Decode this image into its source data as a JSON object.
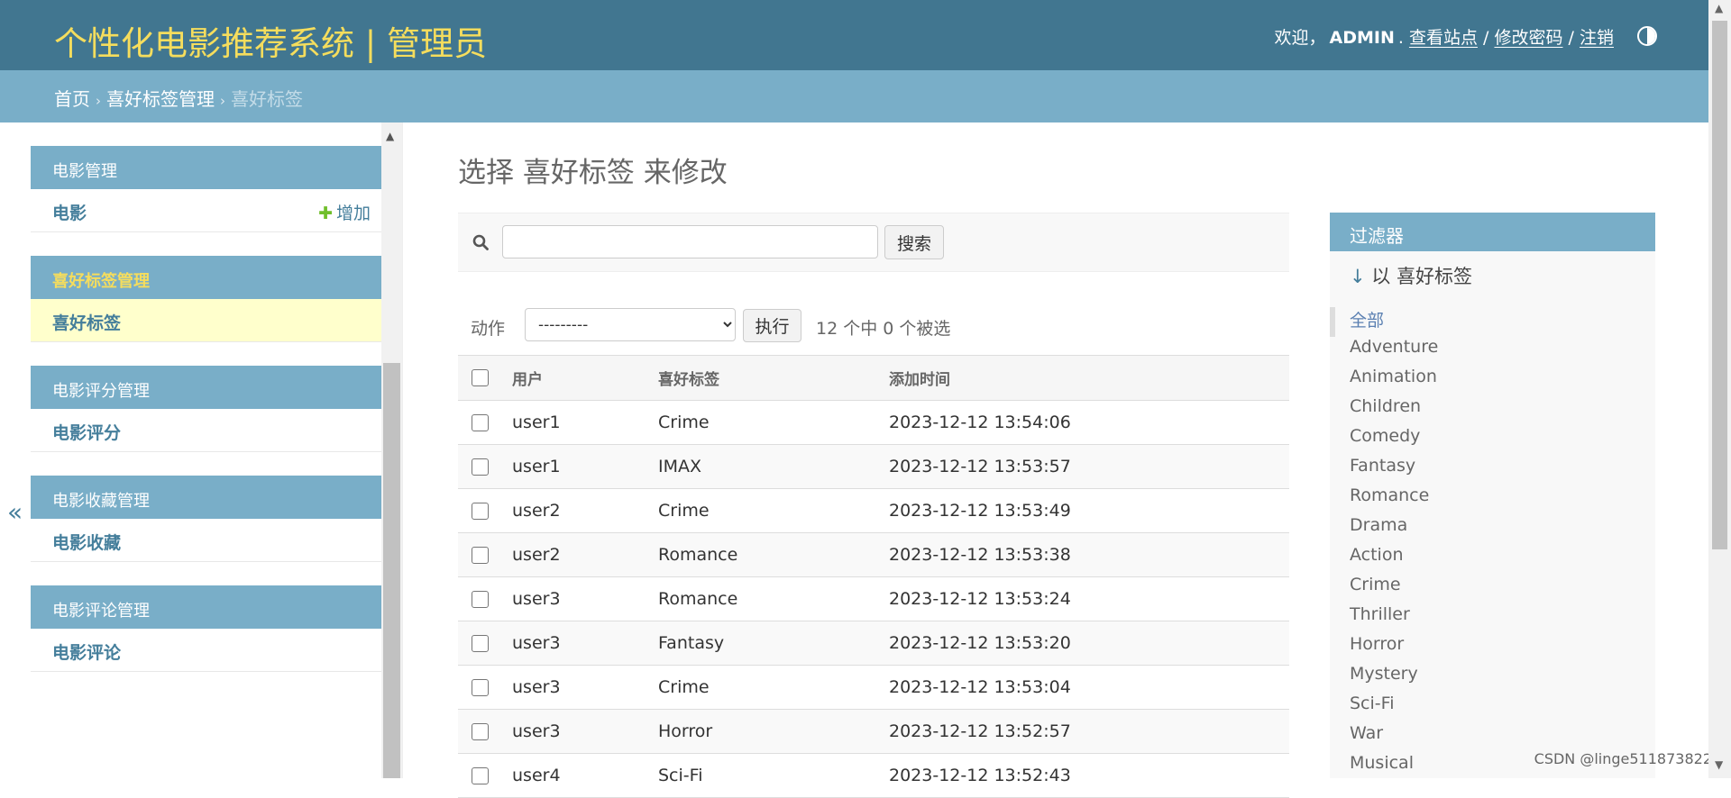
{
  "header": {
    "branding": "个性化电影推荐系统 | 管理员",
    "welcome": "欢迎，",
    "username": "ADMIN",
    "punct": ".",
    "view_site": "查看站点",
    "change_password": "修改密码",
    "logout": "注销",
    "sep": "/"
  },
  "breadcrumbs": {
    "home": "首页",
    "app": "喜好标签管理",
    "current": "喜好标签",
    "separator": "›"
  },
  "sidebar": {
    "add_label": "增加",
    "toggle_label": "«",
    "modules": [
      {
        "caption": "电影管理",
        "item": "电影",
        "has_add": true
      },
      {
        "caption": "喜好标签管理",
        "item": "喜好标签",
        "active": true
      },
      {
        "caption": "电影评分管理",
        "item": "电影评分"
      },
      {
        "caption": "电影收藏管理",
        "item": "电影收藏"
      },
      {
        "caption": "电影评论管理",
        "item": "电影评论"
      }
    ]
  },
  "content": {
    "title": "选择 喜好标签 来修改",
    "search_button": "搜索",
    "search_value": "",
    "action_label": "动作",
    "action_selected": "---------",
    "go_button": "执行",
    "counter": "12 个中 0 个被选",
    "columns": [
      "用户",
      "喜好标签",
      "添加时间"
    ],
    "rows": [
      {
        "user": "user1",
        "tag": "Crime",
        "time": "2023-12-12 13:54:06"
      },
      {
        "user": "user1",
        "tag": "IMAX",
        "time": "2023-12-12 13:53:57"
      },
      {
        "user": "user2",
        "tag": "Crime",
        "time": "2023-12-12 13:53:49"
      },
      {
        "user": "user2",
        "tag": "Romance",
        "time": "2023-12-12 13:53:38"
      },
      {
        "user": "user3",
        "tag": "Romance",
        "time": "2023-12-12 13:53:24"
      },
      {
        "user": "user3",
        "tag": "Fantasy",
        "time": "2023-12-12 13:53:20"
      },
      {
        "user": "user3",
        "tag": "Crime",
        "time": "2023-12-12 13:53:04"
      },
      {
        "user": "user3",
        "tag": "Horror",
        "time": "2023-12-12 13:52:57"
      },
      {
        "user": "user4",
        "tag": "Sci-Fi",
        "time": "2023-12-12 13:52:43"
      }
    ]
  },
  "filter": {
    "caption": "过滤器",
    "by_arrow": "↓",
    "by_label": "以 喜好标签",
    "options": [
      "全部",
      "Adventure",
      "Animation",
      "Children",
      "Comedy",
      "Fantasy",
      "Romance",
      "Drama",
      "Action",
      "Crime",
      "Thriller",
      "Horror",
      "Mystery",
      "Sci-Fi",
      "War",
      "Musical"
    ],
    "selected_index": 0
  },
  "watermark": "CSDN @linge511873822",
  "colors": {
    "header_bg": "#417690",
    "branding": "#f5dd5d",
    "breadcrumb_bg": "#79aec8",
    "link": "#447e9b",
    "current_row": "#ffffcc",
    "add_plus": "#70bf2b"
  }
}
